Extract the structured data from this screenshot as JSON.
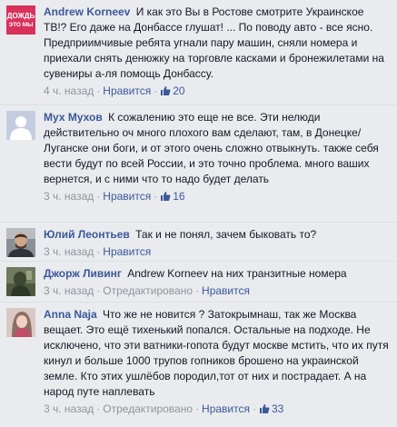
{
  "comments": [
    {
      "author": "Andrew Korneev",
      "text": "И как это Вы в Ростове смотрите Украинское ТВ!? Его даже на Донбассе глушат! ... По поводу авто - все ясно. Предприимчивые ребята угнали пару машин, сняли номера и приехали снять денюжку на торговле касками и бронежилетами на сувениры а-ля помощь Донбассу.",
      "time": "4 ч. назад",
      "like_label": "Нравится",
      "likes": "20",
      "avatar_lines": [
        "ДОЖДЬ",
        "ЭТО МЫ"
      ]
    },
    {
      "author": "Мух Мухов",
      "text": "К сожалению это еще не все. Эти нелюди действительно оч много плохого вам сделают, там, в Донецке/Луганске они боги, и от этого очень сложно отвыкнуть. также себя вести будут по всей России, и это точно проблема. много ваших вернется, и с ними что то надо будет делать",
      "time": "3 ч. назад",
      "like_label": "Нравится",
      "likes": "16"
    },
    {
      "author": "Юлий Леонтьев",
      "text": "Так и не понял, зачем быковать то?",
      "time": "3 ч. назад",
      "like_label": "Нравится"
    },
    {
      "author": "Джорж Ливинг",
      "text": "Andrew Korneev на них транзитные номера",
      "time": "3 ч. назад",
      "edited": "Отредактировано",
      "like_label": "Нравится"
    },
    {
      "author": "Anna Naja",
      "text": "Что же не новится ? Затокрымнаш, так же Москва вещает. Это ещё тихенький попался. Остальные на подходе. Не исключено, что эти ватники-гопота будут москве мстить, что их путя кинул и больше 1000 трупов гопников брошено на украинской земле. Кто этих ушлёбов породил,тот от них и пострадает. А на народ путе наплевать",
      "time": "3 ч. назад",
      "edited": "Отредактировано",
      "like_label": "Нравится",
      "likes": "33"
    }
  ],
  "colors": {
    "link": "#3b5998",
    "meta": "#90949c",
    "background": "#e9ebee",
    "avatar_red": "#d9315b"
  },
  "icons": {
    "like": "thumbs-up-icon"
  }
}
